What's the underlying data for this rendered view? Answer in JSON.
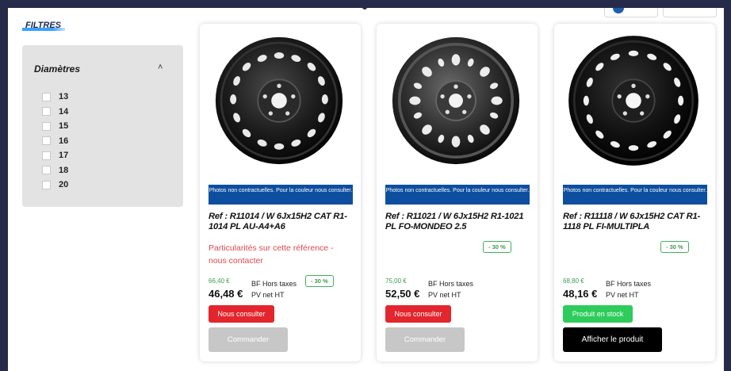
{
  "filters": {
    "title": "FILTRES",
    "group_title": "Diamètres",
    "options": [
      "13",
      "14",
      "15",
      "16",
      "17",
      "18",
      "20"
    ]
  },
  "cards": [
    {
      "photo_note": "Photos non contractuelles. Pour la couleur nous consulter.",
      "ref": "Ref : R11014 / W 6Jx15H2 CAT R1-1014 PL AU-A4+A6",
      "special": "Particularités sur cette référence - nous contacter",
      "discount": "- 30 %",
      "old_price": "66,40 €",
      "price": "46,48 €",
      "label_bf": "BF Hors taxes",
      "label_pv": "PV net HT",
      "status_button": "Nous consulter",
      "action_button": "Commander"
    },
    {
      "photo_note": "Photos non contractuelles. Pour la couleur nous consulter.",
      "ref": "Ref : R11021 / W 6Jx15H2 R1-1021 PL FO-MONDEO 2.5",
      "special": "",
      "discount": "- 30 %",
      "old_price": "75,00 €",
      "price": "52,50 €",
      "label_bf": "BF Hors taxes",
      "label_pv": "PV net HT",
      "status_button": "Nous consulter",
      "action_button": "Commander"
    },
    {
      "photo_note": "Photos non contractuelles. Pour la couleur nous consulter.",
      "ref": "Ref : R11118 / W 6Jx15H2 CAT R1-1118 PL FI-MULTIPLA",
      "special": "",
      "discount": "- 30 %",
      "old_price": "68,80 €",
      "price": "48,16 €",
      "label_bf": "BF Hors taxes",
      "label_pv": "PV net HT",
      "status_button": "Produit en stock",
      "action_button": "Afficher le produit"
    }
  ],
  "colors": {
    "note_bg": "#0d4f9e",
    "consult": "#e3262d",
    "stock": "#2ecc5a",
    "discount": "#43b05c",
    "special_text": "#e0484f"
  }
}
